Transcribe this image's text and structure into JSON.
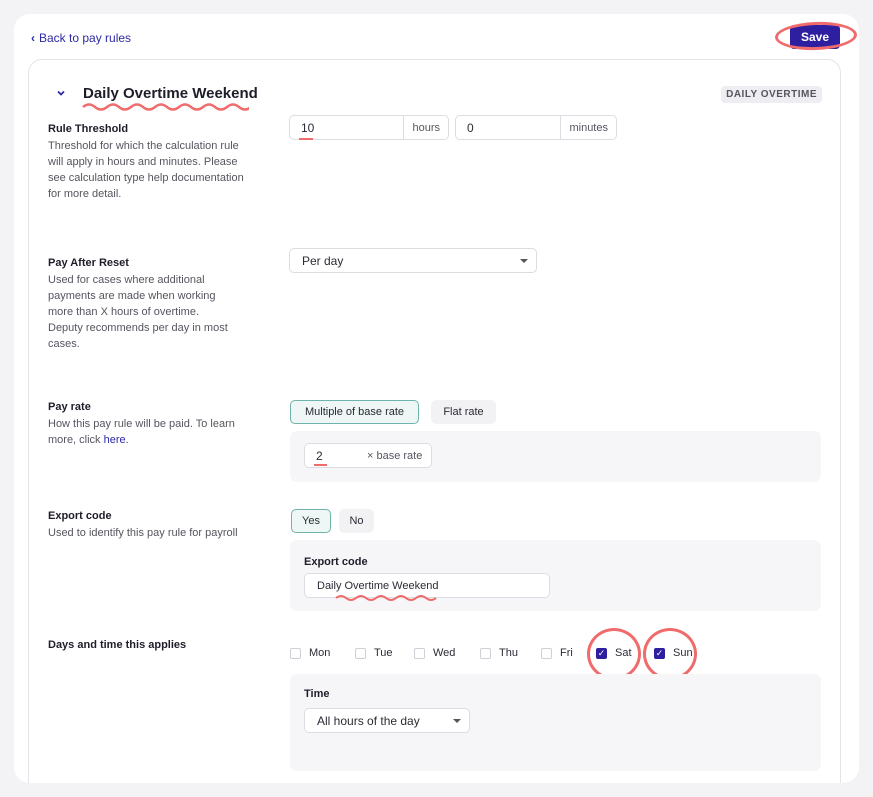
{
  "nav": {
    "back_label": "Back to pay rules",
    "save_label": "Save"
  },
  "rule": {
    "title": "Daily Overtime Weekend",
    "type_badge": "DAILY OVERTIME"
  },
  "threshold": {
    "label": "Rule Threshold",
    "description": "Threshold for which the calculation rule will apply in hours and minutes. Please see calculation type help documentation for more detail.",
    "hours_value": "10",
    "hours_unit": "hours",
    "minutes_value": "0",
    "minutes_unit": "minutes"
  },
  "pay_after_reset": {
    "label": "Pay After Reset",
    "description": "Used for cases where additional payments are made when working more than X hours of overtime. Deputy recommends per day in most cases.",
    "selected": "Per day"
  },
  "pay_rate": {
    "label": "Pay rate",
    "description_prefix": "How this pay rule will be paid. To learn more, click ",
    "link": "here",
    "description_suffix": ".",
    "options": [
      "Multiple of base rate",
      "Flat rate"
    ],
    "multiplier_value": "2",
    "multiplier_unit": "× base rate"
  },
  "export_code": {
    "label": "Export code",
    "description": "Used to identify this pay rule for payroll",
    "options": [
      "Yes",
      "No"
    ],
    "field_label": "Export code",
    "field_value": "Daily Overtime Weekend"
  },
  "days": {
    "label": "Days and time this applies",
    "items": [
      {
        "name": "Mon",
        "checked": false
      },
      {
        "name": "Tue",
        "checked": false
      },
      {
        "name": "Wed",
        "checked": false
      },
      {
        "name": "Thu",
        "checked": false
      },
      {
        "name": "Fri",
        "checked": false
      },
      {
        "name": "Sat",
        "checked": true
      },
      {
        "name": "Sun",
        "checked": true
      }
    ],
    "time_label": "Time",
    "time_selected": "All hours of the day"
  },
  "colors": {
    "accent": "#2d1fa0",
    "annotation": "#f06b6b",
    "active_border": "#6fb4a8"
  }
}
